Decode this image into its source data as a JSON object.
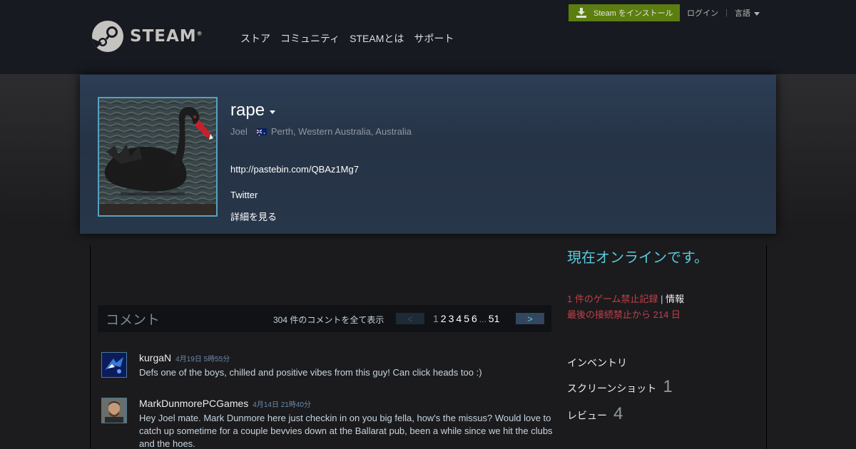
{
  "header": {
    "logo_text": "STEAM",
    "logo_mark": "®",
    "nav": [
      "ストア",
      "コミュニティ",
      "STEAMとは",
      "サポート"
    ],
    "install_label": "Steam をインストール",
    "login_label": "ログイン",
    "separator": "|",
    "language_label": "言語"
  },
  "profile": {
    "persona_name": "rape",
    "real_name": "Joel",
    "location": "Perth, Western Australia, Australia",
    "summary_link": "http://pastebin.com/QBAz1Mg7",
    "summary_twitter": "Twitter",
    "more_info_label": "詳細を見る"
  },
  "comments": {
    "title": "コメント",
    "view_all": "304 件のコメントを全て表示",
    "prev_label": "<",
    "next_label": ">",
    "current_page": "1",
    "pages": [
      "2",
      "3",
      "4",
      "5",
      "6"
    ],
    "ellipsis": "...",
    "last_page": "51",
    "items": [
      {
        "author": "kurgaN",
        "time": "4月19日 5時55分",
        "text": "Defs one of the boys, chilled and positive vibes from this guy! Can click heads too :)"
      },
      {
        "author": "MarkDunmorePCGames",
        "time": "4月14日 21時40分",
        "text": "Hey Joel mate. Mark Dunmore here just checkin in on you big fella, how's the missus? Would love to catch up sometime for a couple bevvies down at the Ballarat pub, been a while since we hit the clubs and the hoes."
      }
    ]
  },
  "sidebar": {
    "online_status": "現在オンラインです。",
    "ban_record": "1 件のゲーム禁止記録",
    "ban_separator": "|",
    "ban_info": "情報",
    "ban_days": "最後の接続禁止から 214 日",
    "inventory_label": "インベントリ",
    "screenshots_label": "スクリーンショット",
    "screenshots_count": "1",
    "reviews_label": "レビュー",
    "reviews_count": "4"
  },
  "colors": {
    "header_bg": "#171a21",
    "install_green": "#5c7e10",
    "online_blue": "#57cbde",
    "ban_red": "#c0404a",
    "avatar_border": "#57a2c1"
  }
}
